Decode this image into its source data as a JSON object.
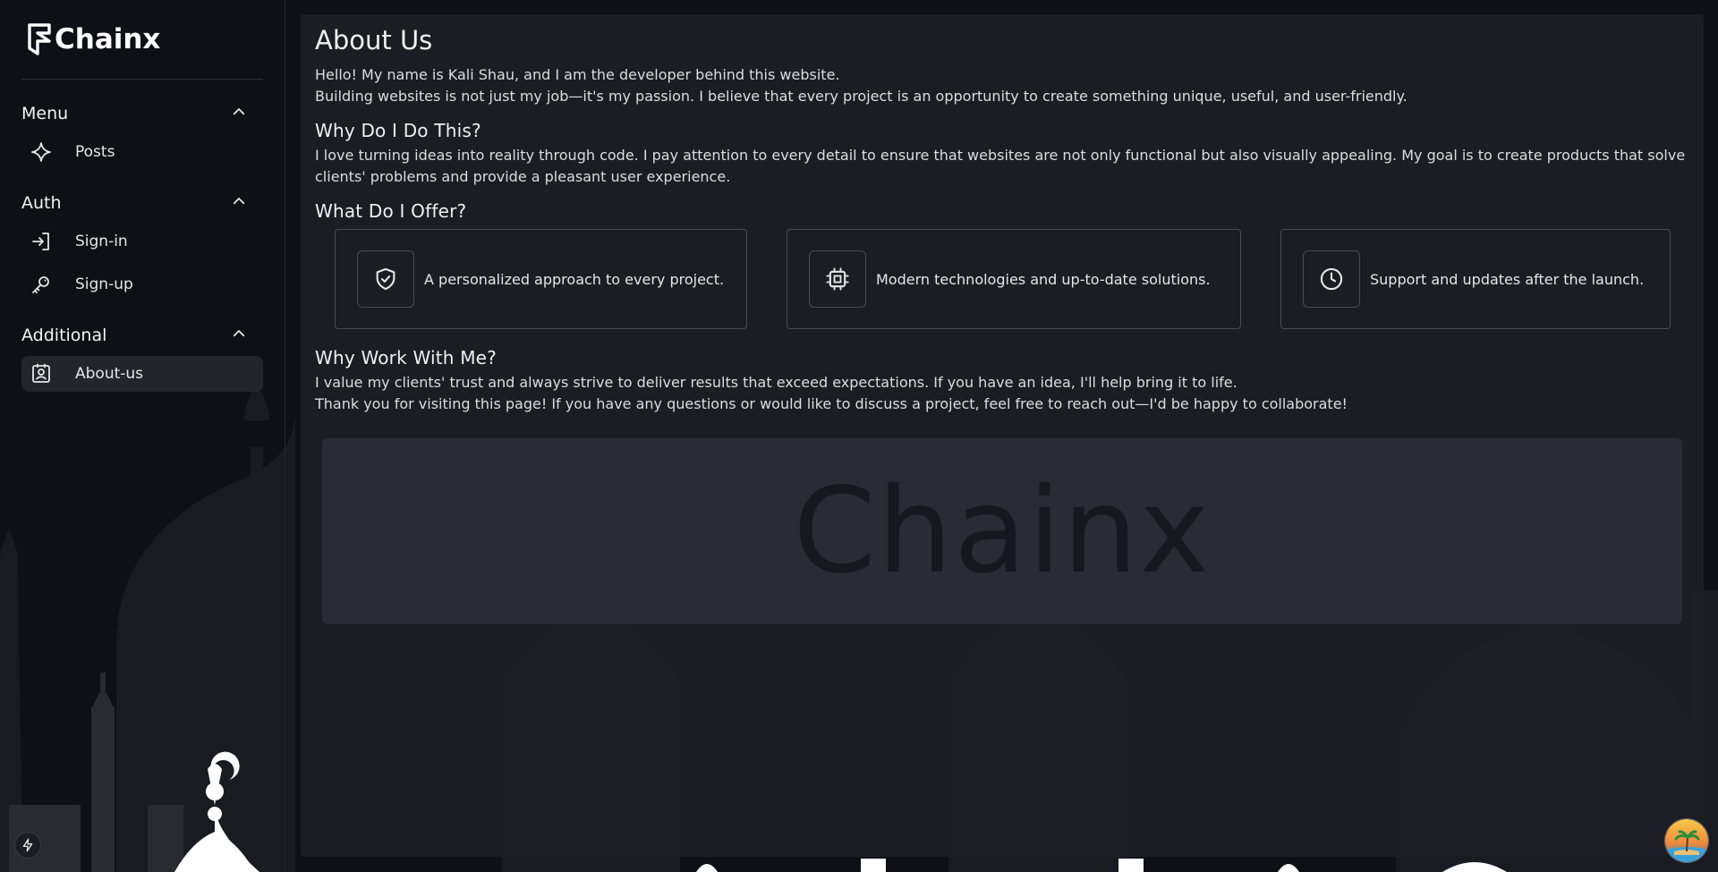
{
  "brand": {
    "name": "Chainx"
  },
  "sidebar": {
    "sections": [
      {
        "title": "Menu",
        "items": [
          {
            "label": "Posts",
            "icon": "sparkle-icon"
          }
        ]
      },
      {
        "title": "Auth",
        "items": [
          {
            "label": "Sign-in",
            "icon": "sign-in-icon"
          },
          {
            "label": "Sign-up",
            "icon": "key-icon"
          }
        ]
      },
      {
        "title": "Additional",
        "items": [
          {
            "label": "About-us",
            "icon": "contact-card-icon",
            "active": true
          }
        ]
      }
    ]
  },
  "main": {
    "title": "About Us",
    "intro": [
      "Hello! My name is Kali Shau, and I am the developer behind this website.",
      "Building websites is not just my job—it's my passion. I believe that every project is an opportunity to create something unique, useful, and user-friendly."
    ],
    "why_heading": "Why Do I Do This?",
    "why_text": "I love turning ideas into reality through code. I pay attention to every detail to ensure that websites are not only functional but also visually appealing. My goal is to create products that solve clients' problems and provide a pleasant user experience.",
    "offer_heading": "What Do I Offer?",
    "offers": [
      {
        "icon": "shield-check-icon",
        "text": "A personalized approach to every project."
      },
      {
        "icon": "cpu-chip-icon",
        "text": "Modern technologies and up-to-date solutions."
      },
      {
        "icon": "clock-icon",
        "text": "Support and updates after the launch."
      }
    ],
    "work_heading": "Why Work With Me?",
    "work_text": [
      "I value my clients' trust and always strive to deliver results that exceed expectations. If you have an idea, I'll help bring it to life.",
      "Thank you for visiting this page! If you have any questions or would like to discuss a project, feel free to reach out—I'd be happy to collaborate!"
    ],
    "banner_text": "Chainx"
  },
  "colors": {
    "background": "#0f0f17",
    "panel": "#1e1e26",
    "card_border": "#4a4a56",
    "banner": "#2b2b35"
  }
}
